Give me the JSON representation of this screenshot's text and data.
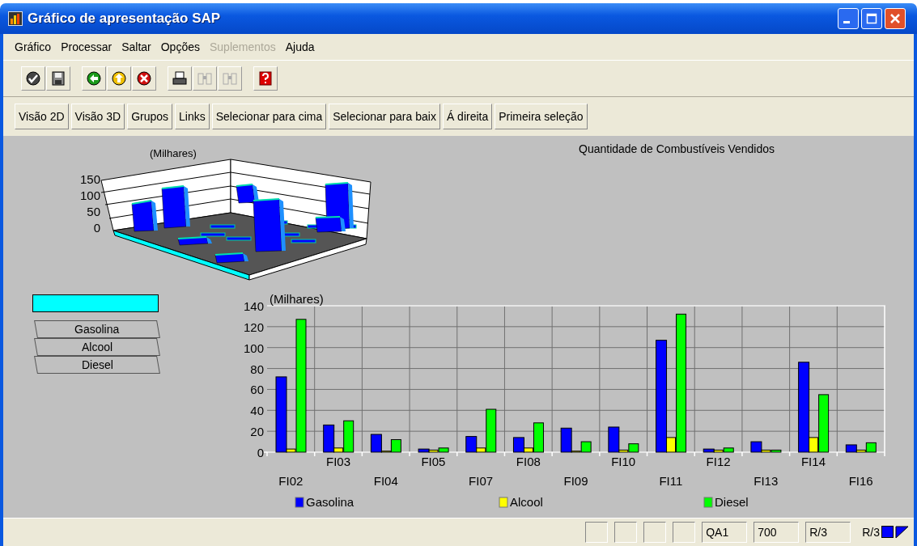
{
  "window": {
    "title": "Gráfico de apresentação SAP"
  },
  "menu": [
    {
      "label": "Gráfico",
      "disabled": false
    },
    {
      "label": "Processar",
      "disabled": false
    },
    {
      "label": "Saltar",
      "disabled": false
    },
    {
      "label": "Opções",
      "disabled": false
    },
    {
      "label": "Suplementos",
      "disabled": true
    },
    {
      "label": "Ajuda",
      "disabled": false
    }
  ],
  "toolbar": [
    [
      {
        "kind": "check",
        "disabled": false
      },
      {
        "kind": "save",
        "disabled": false
      }
    ],
    [
      {
        "kind": "back",
        "disabled": false
      },
      {
        "kind": "exit",
        "disabled": false
      },
      {
        "kind": "cancel",
        "disabled": false
      }
    ],
    [
      {
        "kind": "print",
        "disabled": false
      },
      {
        "kind": "find",
        "disabled": true
      },
      {
        "kind": "find-next",
        "disabled": true
      }
    ],
    [
      {
        "kind": "help",
        "disabled": false
      }
    ]
  ],
  "buttons": [
    "Visão 2D",
    "Visão 3D",
    "Grupos",
    "Links",
    "Selecionar para cima",
    "Selecionar para baix",
    "Á direita",
    "Primeira seleção"
  ],
  "chart_3d": {
    "unit_label": "(Milhares)",
    "tick_labels": [
      "150",
      "100",
      "50",
      "0"
    ]
  },
  "chart_title": "Quantidade de Combustíveis Vendidos",
  "legend_tabs": [
    "Gasolina",
    "Alcool",
    "Diesel"
  ],
  "chart": {
    "chart_data": {
      "type": "bar",
      "grid": true,
      "legend": true,
      "ylabel": "(Milhares)",
      "categories": [
        "FI02",
        "FI03",
        "FI04",
        "FI05",
        "FI07",
        "FI08",
        "FI09",
        "FI10",
        "FI11",
        "FI12",
        "FI13",
        "FI14",
        "FI16"
      ],
      "ylim": [
        0,
        140
      ],
      "yticks": [
        {
          "value": 0,
          "label": "0"
        },
        {
          "value": 20,
          "label": "20"
        },
        {
          "value": 40,
          "label": "40"
        },
        {
          "value": 60,
          "label": "60"
        },
        {
          "value": 80,
          "label": "80"
        },
        {
          "value": 100,
          "label": "100"
        },
        {
          "value": 120,
          "label": "120"
        },
        {
          "value": 140,
          "label": "140"
        }
      ],
      "series": [
        {
          "name": "Gasolina",
          "color": "#0000ff",
          "values": [
            72,
            26,
            17,
            3,
            15,
            14,
            23,
            24,
            107,
            3,
            10,
            86,
            7
          ]
        },
        {
          "name": "Alcool",
          "color": "#ffff00",
          "values": [
            3,
            4,
            1,
            2,
            4,
            4,
            1,
            2,
            14,
            2,
            2,
            14,
            2
          ]
        },
        {
          "name": "Diesel",
          "color": "#00ff00",
          "values": [
            127,
            30,
            12,
            4,
            41,
            28,
            10,
            8,
            132,
            4,
            2,
            55,
            9
          ]
        }
      ]
    }
  },
  "status_bar": {
    "fields": [
      "QA1",
      "700",
      "R/3"
    ],
    "system": "R/3"
  }
}
